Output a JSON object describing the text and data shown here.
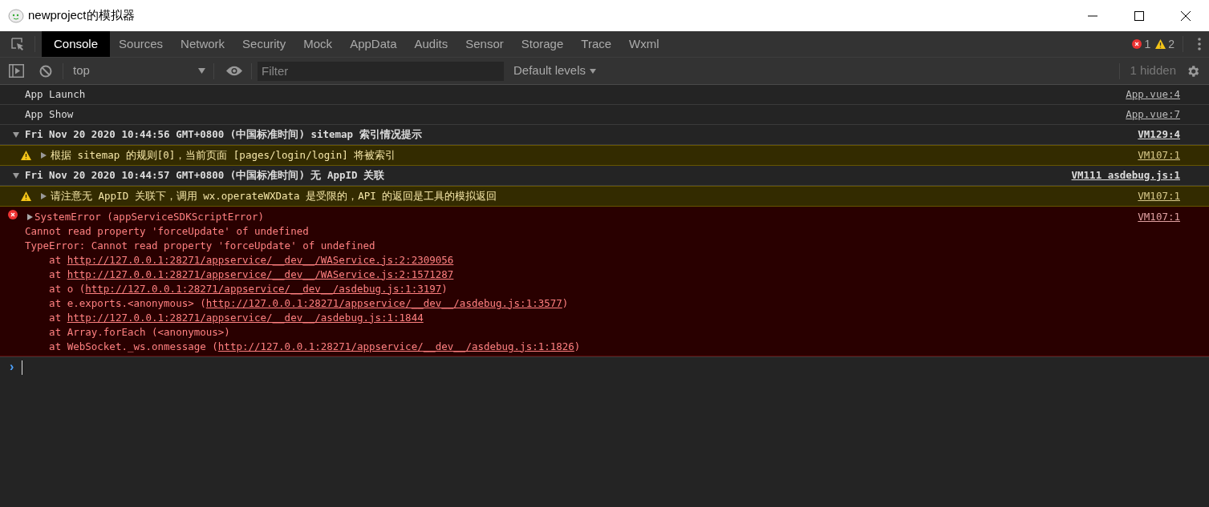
{
  "window": {
    "title": "newproject的模拟器"
  },
  "tabs": [
    {
      "label": "Console",
      "selected": true
    },
    {
      "label": "Sources",
      "selected": false
    },
    {
      "label": "Network",
      "selected": false
    },
    {
      "label": "Security",
      "selected": false
    },
    {
      "label": "Mock",
      "selected": false
    },
    {
      "label": "AppData",
      "selected": false
    },
    {
      "label": "Audits",
      "selected": false
    },
    {
      "label": "Sensor",
      "selected": false
    },
    {
      "label": "Storage",
      "selected": false
    },
    {
      "label": "Trace",
      "selected": false
    },
    {
      "label": "Wxml",
      "selected": false
    }
  ],
  "counts": {
    "errors": "1",
    "warnings": "2"
  },
  "toolbar": {
    "context": "top",
    "filter_placeholder": "Filter",
    "levels": "Default levels",
    "hidden": "1 hidden"
  },
  "messages": [
    {
      "kind": "log",
      "text": "App Launch",
      "source": "App.vue:4"
    },
    {
      "kind": "log",
      "text": "App Show",
      "source": "App.vue:7"
    },
    {
      "kind": "group",
      "expanded": true,
      "text": "Fri Nov 20 2020 10:44:56 GMT+0800 (中国标准时间) sitemap 索引情况提示",
      "source": "VM129:4"
    },
    {
      "kind": "warning",
      "expanded": false,
      "text": "根据 sitemap 的规则[0]，当前页面 [pages/login/login] 将被索引",
      "source": "VM107:1"
    },
    {
      "kind": "group",
      "expanded": true,
      "text": "Fri Nov 20 2020 10:44:57 GMT+0800 (中国标准时间) 无 AppID 关联",
      "source": "VM111 asdebug.js:1"
    },
    {
      "kind": "warning",
      "expanded": false,
      "text": "请注意无 AppID 关联下，调用 wx.operateWXData 是受限的，API 的返回是工具的模拟返回",
      "source": "VM107:1"
    },
    {
      "kind": "error",
      "expanded": false,
      "text": "SystemError (appServiceSDKScriptError)",
      "source": "VM107:1",
      "lines": [
        [
          {
            "kind": "plain",
            "text": "Cannot read property 'forceUpdate' of undefined"
          }
        ],
        [
          {
            "kind": "plain",
            "text": "TypeError: Cannot read property 'forceUpdate' of undefined"
          }
        ],
        [
          {
            "kind": "plain",
            "text": "    at "
          },
          {
            "kind": "link",
            "text": "http://127.0.0.1:28271/appservice/__dev__/WAService.js:2:2309056"
          }
        ],
        [
          {
            "kind": "plain",
            "text": "    at "
          },
          {
            "kind": "link",
            "text": "http://127.0.0.1:28271/appservice/__dev__/WAService.js:2:1571287"
          }
        ],
        [
          {
            "kind": "plain",
            "text": "    at o ("
          },
          {
            "kind": "link",
            "text": "http://127.0.0.1:28271/appservice/__dev__/asdebug.js:1:3197"
          },
          {
            "kind": "plain",
            "text": ")"
          }
        ],
        [
          {
            "kind": "plain",
            "text": "    at e.exports.<anonymous> ("
          },
          {
            "kind": "link",
            "text": "http://127.0.0.1:28271/appservice/__dev__/asdebug.js:1:3577"
          },
          {
            "kind": "plain",
            "text": ")"
          }
        ],
        [
          {
            "kind": "plain",
            "text": "    at "
          },
          {
            "kind": "link",
            "text": "http://127.0.0.1:28271/appservice/__dev__/asdebug.js:1:1844"
          }
        ],
        [
          {
            "kind": "plain",
            "text": "    at Array.forEach (<anonymous>)"
          }
        ],
        [
          {
            "kind": "plain",
            "text": "    at WebSocket._ws.onmessage ("
          },
          {
            "kind": "link",
            "text": "http://127.0.0.1:28271/appservice/__dev__/asdebug.js:1:1826"
          },
          {
            "kind": "plain",
            "text": ")"
          }
        ]
      ]
    }
  ],
  "prompt": {
    "symbol": "›"
  }
}
